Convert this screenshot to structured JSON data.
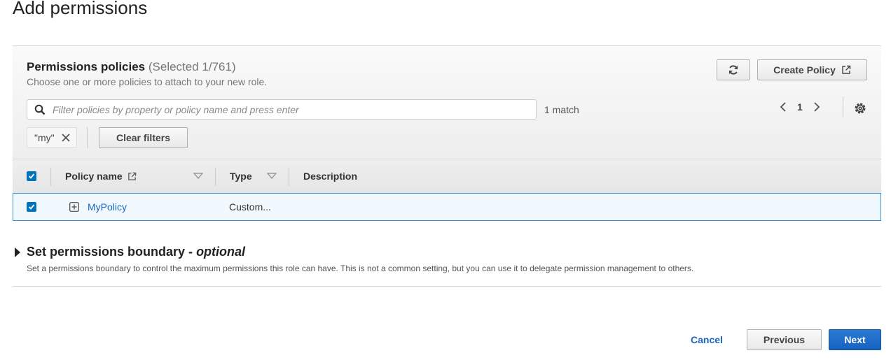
{
  "page": {
    "title": "Add permissions"
  },
  "policies_panel": {
    "title": "Permissions policies",
    "selected_count": "(Selected 1/761)",
    "subtitle": "Choose one or more policies to attach to your new role.",
    "refresh_icon": "refresh-icon",
    "create_policy_label": "Create Policy",
    "create_policy_icon": "external-link-icon",
    "search": {
      "placeholder": "Filter policies by property or policy name and press enter",
      "value": ""
    },
    "match_text": "1 match",
    "pagination": {
      "current_page": "1"
    },
    "filter_token": "\"my\"",
    "clear_filters_label": "Clear filters",
    "table": {
      "columns": [
        "Policy name",
        "Type",
        "Description"
      ],
      "select_all_checked": true,
      "rows": [
        {
          "checked": true,
          "name": "MyPolicy",
          "type": "Custom...",
          "description": ""
        }
      ]
    }
  },
  "boundary": {
    "title": "Set permissions boundary - ",
    "title_optional": "optional",
    "description": "Set a permissions boundary to control the maximum permissions this role can have. This is not a common setting, but you can use it to delegate permission management to others."
  },
  "footer": {
    "cancel_label": "Cancel",
    "previous_label": "Previous",
    "next_label": "Next"
  },
  "colors": {
    "primary": "#1662c0",
    "link": "#1a66c2",
    "selected_row": "#f1f8fe"
  }
}
